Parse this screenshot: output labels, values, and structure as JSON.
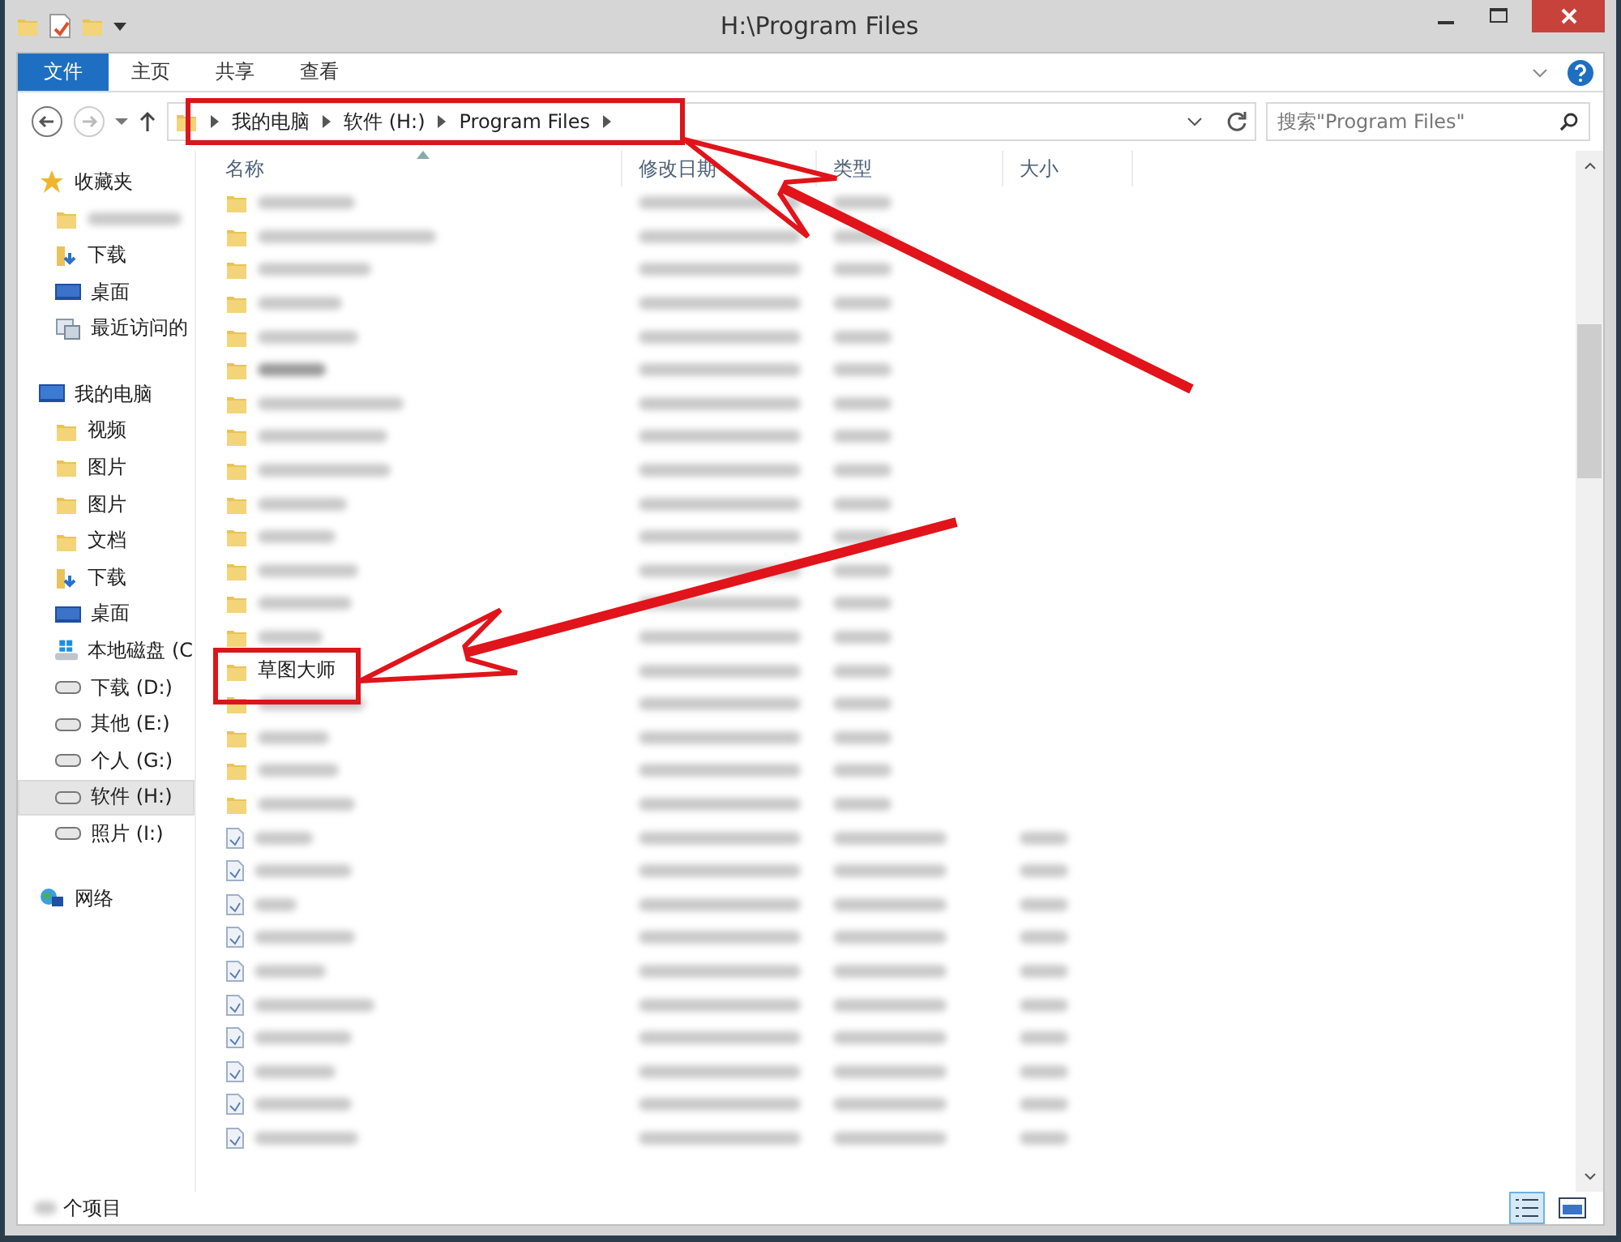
{
  "window": {
    "title": "H:\\Program Files"
  },
  "ribbon_tabs": [
    {
      "label": "文件",
      "kind": "file"
    },
    {
      "label": "主页",
      "kind": "tab"
    },
    {
      "label": "共享",
      "kind": "tab"
    },
    {
      "label": "查看",
      "kind": "tab"
    }
  ],
  "address": {
    "crumbs": [
      "我的电脑",
      "软件 (H:)",
      "Program Files"
    ]
  },
  "search": {
    "placeholder": "搜索\"Program Files\""
  },
  "sidebar": [
    {
      "label": "收藏夹",
      "selected": false,
      "children": [
        {
          "selected": false
        },
        {
          "label": "下载",
          "selected": false
        },
        {
          "label": "桌面",
          "selected": false
        },
        {
          "label": "最近访问的",
          "selected": false
        }
      ]
    },
    {
      "label": "我的电脑",
      "selected": false,
      "children": [
        {
          "label": "视频",
          "selected": false
        },
        {
          "label": "图片",
          "selected": false
        },
        {
          "label": "图片",
          "selected": false
        },
        {
          "label": "文档",
          "selected": false
        },
        {
          "label": "下载",
          "selected": false
        },
        {
          "label": "桌面",
          "selected": false
        },
        {
          "label": "本地磁盘 (C",
          "selected": false
        },
        {
          "label": "下载 (D:)",
          "selected": false
        },
        {
          "label": "其他 (E:)",
          "selected": false
        },
        {
          "label": "个人 (G:)",
          "selected": false
        },
        {
          "label": "软件 (H:)",
          "selected": true
        },
        {
          "label": "照片 (I:)",
          "selected": false
        }
      ]
    },
    {
      "label": "网络",
      "selected": false
    }
  ],
  "table": {
    "columns": [
      "名称",
      "修改日期",
      "类型",
      "大小"
    ],
    "rows": [
      {
        "kind": "folder"
      },
      {
        "kind": "folder"
      },
      {
        "kind": "folder"
      },
      {
        "kind": "folder"
      },
      {
        "kind": "folder"
      },
      {
        "kind": "folder"
      },
      {
        "kind": "folder"
      },
      {
        "kind": "folder"
      },
      {
        "kind": "folder"
      },
      {
        "kind": "folder"
      },
      {
        "kind": "folder"
      },
      {
        "kind": "folder"
      },
      {
        "kind": "folder"
      },
      {
        "kind": "folder"
      },
      {
        "kind": "folder",
        "name": "草图大师"
      },
      {
        "kind": "folder"
      },
      {
        "kind": "folder"
      },
      {
        "kind": "folder"
      },
      {
        "kind": "folder"
      },
      {
        "kind": "file"
      },
      {
        "kind": "file"
      },
      {
        "kind": "file"
      },
      {
        "kind": "file"
      },
      {
        "kind": "file"
      },
      {
        "kind": "file"
      },
      {
        "kind": "file"
      },
      {
        "kind": "file"
      },
      {
        "kind": "file"
      },
      {
        "kind": "file"
      }
    ]
  },
  "status_bar": {
    "text": "个项目"
  }
}
